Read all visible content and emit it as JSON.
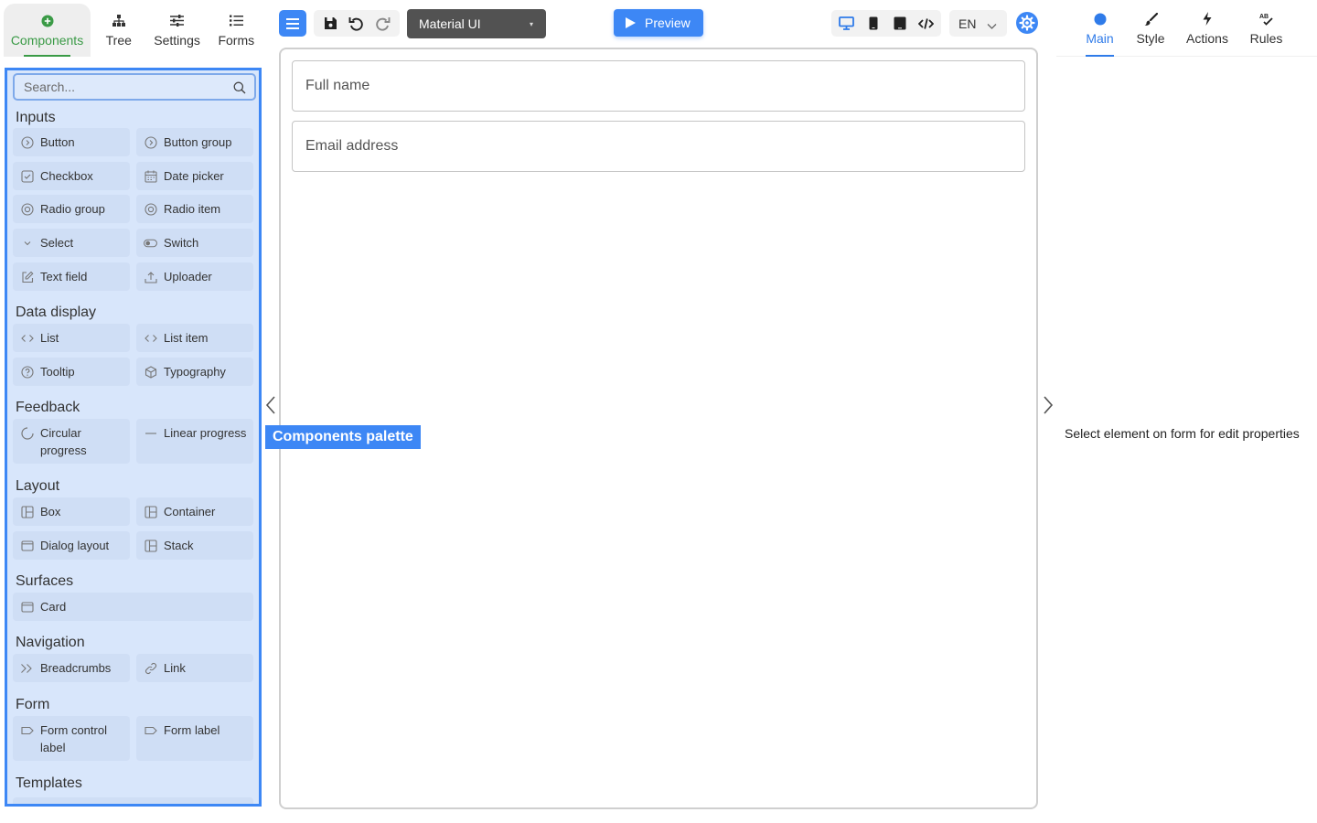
{
  "left_tabs": [
    {
      "label": "Components",
      "icon": "plus-circle-icon",
      "active": true
    },
    {
      "label": "Tree",
      "icon": "tree-icon",
      "active": false
    },
    {
      "label": "Settings",
      "icon": "sliders-icon",
      "active": false
    },
    {
      "label": "Forms",
      "icon": "list-icon",
      "active": false
    }
  ],
  "palette": {
    "search_placeholder": "Search...",
    "categories": {
      "inputs": "Inputs",
      "data_display": "Data display",
      "feedback": "Feedback",
      "layout": "Layout",
      "surfaces": "Surfaces",
      "navigation": "Navigation",
      "form": "Form",
      "templates": "Templates"
    },
    "items": {
      "button": "Button",
      "button_group": "Button group",
      "checkbox": "Checkbox",
      "date_picker": "Date picker",
      "radio_group": "Radio group",
      "radio_item": "Radio item",
      "select": "Select",
      "switch": "Switch",
      "text_field": "Text field",
      "uploader": "Uploader",
      "list": "List",
      "list_item": "List item",
      "tooltip": "Tooltip",
      "typography": "Typography",
      "circular_progress": "Circular progress",
      "linear_progress": "Linear progress",
      "box": "Box",
      "container": "Container",
      "dialog_layout": "Dialog layout",
      "stack": "Stack",
      "card": "Card",
      "breadcrumbs": "Breadcrumbs",
      "link": "Link",
      "form_control_label": "Form control label",
      "form_label": "Form label"
    }
  },
  "toolbar": {
    "theme_select": "Material UI",
    "preview": "Preview",
    "language": "EN",
    "accent_color": "#3d87f5"
  },
  "canvas": {
    "fields": [
      {
        "placeholder": "Full name"
      },
      {
        "placeholder": "Email address"
      }
    ]
  },
  "overlay_label": "Components palette",
  "right_tabs": [
    {
      "label": "Main",
      "icon": "circle-icon",
      "active": true
    },
    {
      "label": "Style",
      "icon": "brush-icon",
      "active": false
    },
    {
      "label": "Actions",
      "icon": "bolt-icon",
      "active": false
    },
    {
      "label": "Rules",
      "icon": "ab-check-icon",
      "active": false
    }
  ],
  "properties_hint": "Select element on form for edit properties"
}
